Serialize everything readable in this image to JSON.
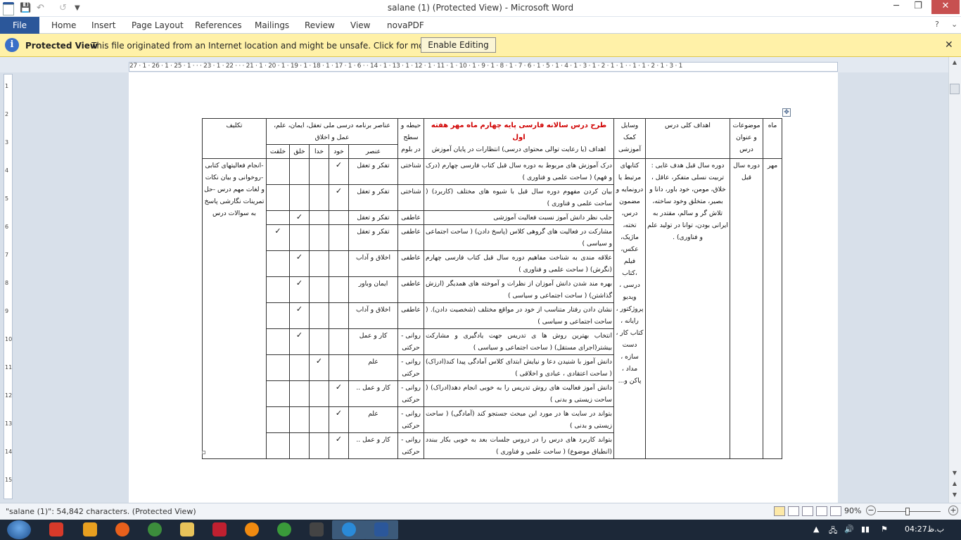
{
  "app": {
    "title": "salane (1) (Protected View)  -  Microsoft Word",
    "word_icon": "W"
  },
  "quick_access": {
    "save_icon": "save-icon",
    "undo_icon": "undo-icon",
    "redo_icon": "redo-icon",
    "customize_icon": "customize-icon"
  },
  "window_controls": {
    "minimize": "─",
    "maximize": "❐",
    "close": "✕"
  },
  "ribbon": {
    "tabs": [
      "File",
      "Home",
      "Insert",
      "Page Layout",
      "References",
      "Mailings",
      "Review",
      "View",
      "novaPDF"
    ],
    "help": "?",
    "collapse": "⌄"
  },
  "protected": {
    "title": "Protected View",
    "message": "This file originated from an Internet location and might be unsafe. Click for more details.",
    "button": "Enable Editing",
    "close": "✕"
  },
  "ruler": {
    "marks": "27 · 1 · 26 · 1 · 25 · 1 ·  ·  · 23 · 1 · 22 ·  · · 21 · 1 · 20 · 1 · 19 · 1 · 18 · 1 · 17 · 1 ·   6 ·   · 14 · 1 · 13 · 1 · 12 · 1 · 11 · 1 · 10 · 1 · 9 · 1 · 8 · 1 · 7 ·   6 · 1 ·  5 · 1 · 4 · 1 · 3 · 1 · 2 · 1 · 1 ·  · 1 · 1 · 2 · 1 · 3 · 1",
    "vmarks": [
      "1",
      "2",
      "3",
      "4",
      "5",
      "6",
      "7",
      "8",
      "9",
      "10",
      "11",
      "12",
      "13",
      "14",
      "15"
    ]
  },
  "table": {
    "headers": {
      "month": "ماه",
      "topics": "موضوعات و عنوان درس",
      "goals": "اهداف کلی درس",
      "tools": "وسایل کمک آموزشی",
      "plan_title": "طرح درس سالانه فارسی پایه چهارم ماه مهر هفته اول",
      "plan_sub": "اهداف (یا رعایت توالی محتوای درسی) انتظارات در پایان آموزش",
      "bloom": "حیطه و سطح در بلوم",
      "elements": "عناصر برنامه درسی ملی تعقل، ایمان، علم، عمل و اخلاق",
      "element": "عنصر",
      "self": "خود",
      "god": "خدا",
      "creation": "خلق",
      "nature": "خلقت",
      "homework": "تکلیف"
    },
    "month": "مهر",
    "topic": "دوره سال قبل",
    "goals": "دوره سال قبل هدف غایی : تربیت نسلی متفکر، عاقل ، خلاق، مومن، خود باور، دانا و بصیر، متخلق وخود ساخته، تلاش گر و سالم، مقتدر به ایرانی بودن، توانا در تولید علم و فناوری) .",
    "tools": "کتابهای مرتبط یا درونمایه و مضمون درس، تخته، ماژیک، عکس، فیلم ،کتاب درسی ، ویدیو پروژکتور ، رایانه ، کتاب کار ، دست سازه ، مداد ، پاکن و...",
    "homework": "-انجام فعالیتهای کتابی -روخوانی و بیان نکات و لغات مهم درس -حل تمرینات نگارشی پاسخ به سوالات درس",
    "rows": [
      {
        "obj": "درک آموزش های مربوط به دوره سال قبل کتاب فارسی چهارم (درک و فهم) ( ساحت علمی و فناوری )",
        "bloom": "شناختی",
        "elem": "تفکر و تعقل",
        "col": 1
      },
      {
        "obj": "بیان کردن مفهوم دوره سال قبل با شیوه های مختلف (کاربرد) ( ساحت علمی و فناوری )",
        "bloom": "شناختی",
        "elem": "تفکر و تعقل",
        "col": 1
      },
      {
        "obj": "جلب نظر دانش آموز نسبت فعالیت آموزشی",
        "bloom": "عاطفی",
        "elem": "تفکر و تعقل",
        "col": 3
      },
      {
        "obj": "مشارکت در فعالیت های گروهی کلاس (پاسخ دادن) ( ساحت اجتماعی و سیاسی )",
        "bloom": "عاطفی",
        "elem": "تفکر و تعقل",
        "col": 4
      },
      {
        "obj": "علاقه مندی به شناخت مفاهیم دوره سال قبل کتاب فارسی چهارم (نگرش) ( ساحت علمی و فناوری )",
        "bloom": "عاطفی",
        "elem": "اخلاق و آداب",
        "col": 3
      },
      {
        "obj": "بهره مند شدن دانش آموزان از نظرات و آموخته های همدیگر (ارزش گذاشتن) ( ساحت اجتماعی و سیاسی )",
        "bloom": "عاطفی",
        "elem": "ایمان وباور",
        "col": 3
      },
      {
        "obj": "نشان دادن رفتار متناسب از خود در مواقع مختلف (شخصیت دادن). ( ساحت اجتماعی و سیاسی )",
        "bloom": "عاطفی",
        "elem": "اخلاق و آداب",
        "col": 3
      },
      {
        "obj": "انتخاب بهترین روش ها ی تدریس جهت یادگیری و مشارکت بیشتر(اجرای مستقل) ( ساحت اجتماعی و سیاسی )",
        "bloom": "روانی - حرکتی",
        "elem": "کار و عمل",
        "col": 3
      },
      {
        "obj": "دانش آموز با شنیدن دعا و نیایش ابتدای کلاس آمادگی پیدا کند(ادراک) ( ساحت اعتقادی ، عبادی و اخلاقی )",
        "bloom": "روانی - حرکتی",
        "elem": "علم",
        "col": 2
      },
      {
        "obj": "دانش آموز فعالیت های روش تدریس را به خوبی انجام دهد(ادراک) ( ساحت زیستی و بدنی )",
        "bloom": "روانی - حرکتی",
        "elem": "کار و عمل ..",
        "col": 1
      },
      {
        "obj": "بتواند در سایت ها در مورد این مبحث جستجو کند (آمادگی) ( ساحت زیستی و بدنی )",
        "bloom": "روانی - حرکتی",
        "elem": "علم",
        "col": 1
      },
      {
        "obj": "بتواند کاربرد های درس را در دروس جلسات بعد به خوبی بکار ببندد (انطباق موضوع) ( ساحت علمی و فناوری )",
        "bloom": "روانی - حرکتی",
        "elem": "کار و عمل ..",
        "col": 1
      }
    ],
    "check": "✓"
  },
  "status": {
    "text": "\"salane (1)\": 54,842 characters.  (Protected View)",
    "zoom": "90%",
    "minus": "−",
    "plus": "+"
  },
  "tray": {
    "lang": "ب.ظ",
    "time": "04:27",
    "icons": [
      "up-arrow",
      "network",
      "volume",
      "signal"
    ]
  },
  "taskbar": {
    "apps": [
      "media-icon",
      "player-icon",
      "firefox-icon",
      "chrome-icon",
      "folder-icon",
      "app-icon",
      "aimp-icon",
      "utorrent-icon",
      "media2-icon",
      "ie-icon",
      "word-icon"
    ]
  }
}
